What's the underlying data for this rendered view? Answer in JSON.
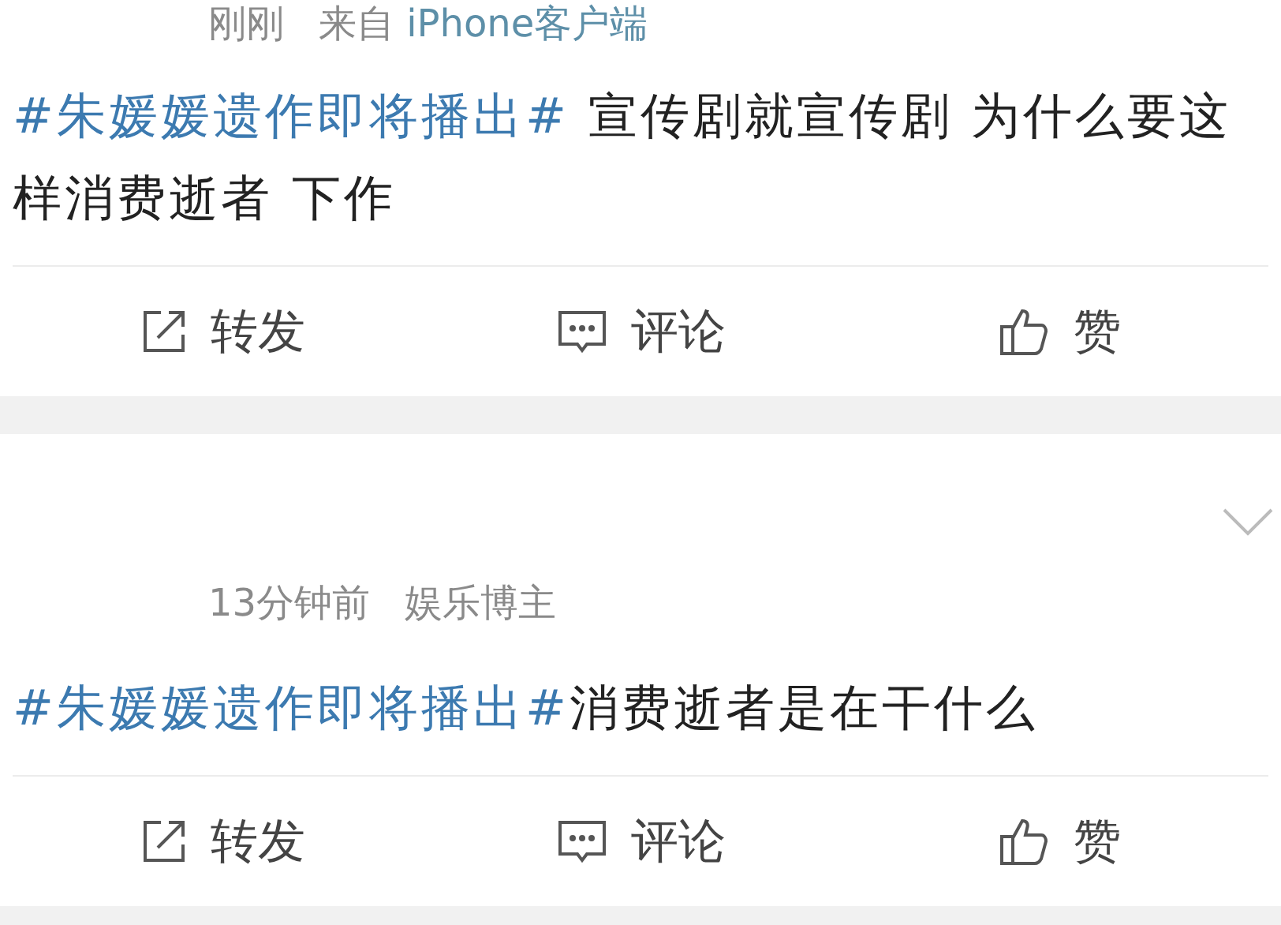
{
  "posts": [
    {
      "meta": {
        "time": "刚刚",
        "source_prefix": "来自",
        "source": "iPhone客户端"
      },
      "has_menu": false,
      "hashtag": "#朱媛媛遗作即将播出#",
      "text": " 宣传剧就宣传剧  为什么要这样消费逝者  下作",
      "actions": [
        {
          "kind": "repost",
          "label": "转发"
        },
        {
          "kind": "comment",
          "label": "评论"
        },
        {
          "kind": "like",
          "label": "赞"
        }
      ]
    },
    {
      "meta": {
        "time": "13分钟前",
        "source_prefix": "娱乐博主"
      },
      "has_menu": true,
      "hashtag": "#朱媛媛遗作即将播出#",
      "text": "消费逝者是在干什么",
      "actions": [
        {
          "kind": "repost",
          "label": "转发"
        },
        {
          "kind": "comment",
          "label": "评论"
        },
        {
          "kind": "like",
          "label": "赞"
        }
      ]
    }
  ]
}
